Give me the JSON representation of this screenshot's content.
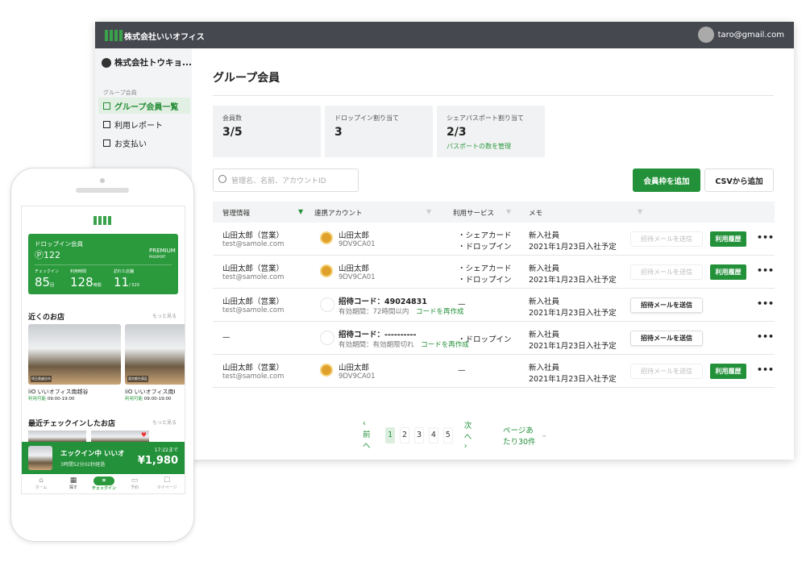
{
  "app": {
    "company": "株式会社いいオフィス",
    "user_email": "taro@gmail.com",
    "brand_color": "#23913a"
  },
  "sidebar": {
    "org": "株式会社トウキョ...",
    "section": "グループ会員",
    "items": [
      {
        "label": "グループ会員一覧",
        "active": true
      },
      {
        "label": "利用レポート"
      },
      {
        "label": "お支払い"
      }
    ]
  },
  "main": {
    "title": "グループ会員",
    "stats": [
      {
        "label": "会員数",
        "value": "3/5"
      },
      {
        "label": "ドロップイン割り当て",
        "value": "3"
      },
      {
        "label": "シェアパスポート割り当て",
        "value": "2/3",
        "link": "パスポートの数を管理"
      }
    ],
    "search_placeholder": "管理名、名前、アカウントID",
    "add_button": "会員枠を追加",
    "csv_button": "CSVから追加",
    "columns": [
      "管理情報",
      "連携アカウント",
      "利用サービス",
      "メモ"
    ],
    "rows": [
      {
        "name": "山田太郎（営業）",
        "email": "test@samole.com",
        "acct": "山田太郎",
        "acct_sub": "9DV9CA01",
        "svc1": "・シェアカード",
        "svc2": "・ドロップイン",
        "memo1": "新入社員",
        "memo2": "2021年1月23日入社予定",
        "invite": "招待メールを送信",
        "invite_enabled": false,
        "history": "利用履歴"
      },
      {
        "name": "山田太郎（営業）",
        "email": "test@samole.com",
        "acct": "山田太郎",
        "acct_sub": "9DV9CA01",
        "svc1": "・シェアカード",
        "svc2": "・ドロップイン",
        "memo1": "新入社員",
        "memo2": "2021年1月23日入社予定",
        "invite": "招待メールを送信",
        "invite_enabled": false,
        "history": "利用履歴"
      },
      {
        "name": "山田太郎（営業）",
        "email": "test@samole.com",
        "acct": "招待コード：49024831",
        "acct_sub": "有効期間：72時間以内",
        "regen": "コードを再作成",
        "svc1": "—",
        "svc2": "",
        "memo1": "新入社員",
        "memo2": "2021年1月23日入社予定",
        "invite": "招待メールを送信",
        "invite_enabled": true
      },
      {
        "name": "—",
        "email": "",
        "acct": "招待コード：----------",
        "acct_sub": "有効期間：有効期限切れ",
        "regen": "コードを再作成",
        "svc1": "・ドロップイン",
        "svc2": "",
        "memo1": "新入社員",
        "memo2": "2021年1月23日入社予定",
        "invite": "招待メールを送信",
        "invite_enabled": true
      },
      {
        "name": "山田太郎（営業）",
        "email": "test@samole.com",
        "acct": "山田太郎",
        "acct_sub": "9DV9CA01",
        "svc1": "—",
        "svc2": "",
        "memo1": "新入社員",
        "memo2": "2021年1月23日入社予定",
        "invite": "招待メールを送信",
        "invite_enabled": false,
        "history": "利用履歴"
      }
    ],
    "more": "•••",
    "pagination": {
      "prev": "‹ 前へ",
      "pages": [
        "1",
        "2",
        "3",
        "4",
        "5"
      ],
      "current": "1",
      "next": "次へ ›",
      "per_page": "ページあたり30件"
    }
  },
  "phone": {
    "member_type": "ドロップイン会員",
    "points": "Ⓟ122",
    "passport": "PREMIUM",
    "passport_sub": "PASSPORT",
    "stats": [
      {
        "label": "チェックイン",
        "value": "85",
        "unit": "回"
      },
      {
        "label": "利用時間",
        "value": "128",
        "unit": "時間"
      },
      {
        "label": "訪れた店舗",
        "value": "11",
        "unit": "/ 520"
      }
    ],
    "nearby_title": "近くのお店",
    "more": "もっと見る",
    "shops": [
      {
        "name": "iiO いいオフィス南越谷",
        "status": "利用可能",
        "hours": "09:00-19:00",
        "area": "埼玉県越谷市"
      },
      {
        "name": "iiO いいオフィス南I",
        "status": "利用可能",
        "hours": "09:00-19:00",
        "area": "東京都台東区"
      }
    ],
    "recent_title": "最近チェックインしたお店",
    "checkin": {
      "title": "エックイン中 いいオ",
      "elapsed": "3時間52分02秒経過",
      "until": "17:22まで",
      "price": "¥1,980"
    },
    "tabs": [
      "ホーム",
      "探す",
      "チェックイン",
      "予約",
      "マイページ"
    ]
  }
}
